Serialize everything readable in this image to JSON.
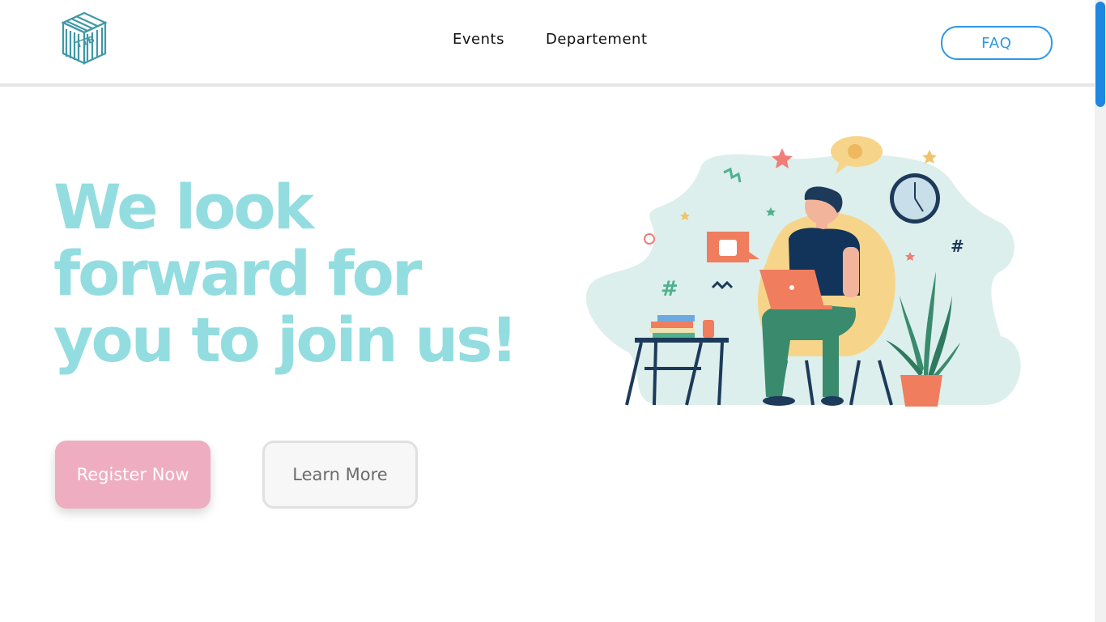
{
  "header": {
    "logo_text": "TTB",
    "nav": [
      {
        "label": "Events"
      },
      {
        "label": "Departement"
      }
    ],
    "faq_label": "FAQ"
  },
  "hero": {
    "title_lines": [
      "We look",
      "forward for",
      "you to join us!"
    ],
    "register_label": "Register Now",
    "learn_more_label": "Learn More"
  },
  "colors": {
    "title": "#93dde0",
    "register_bg": "#efadc1",
    "faq_accent": "#2f97e6",
    "illustration_blob": "#dcefec"
  },
  "illustration": {
    "icons": [
      "person-with-laptop-icon",
      "clock-icon",
      "thumbs-up-icon",
      "plant-icon",
      "books-icon",
      "chair-icon",
      "table-icon"
    ]
  }
}
